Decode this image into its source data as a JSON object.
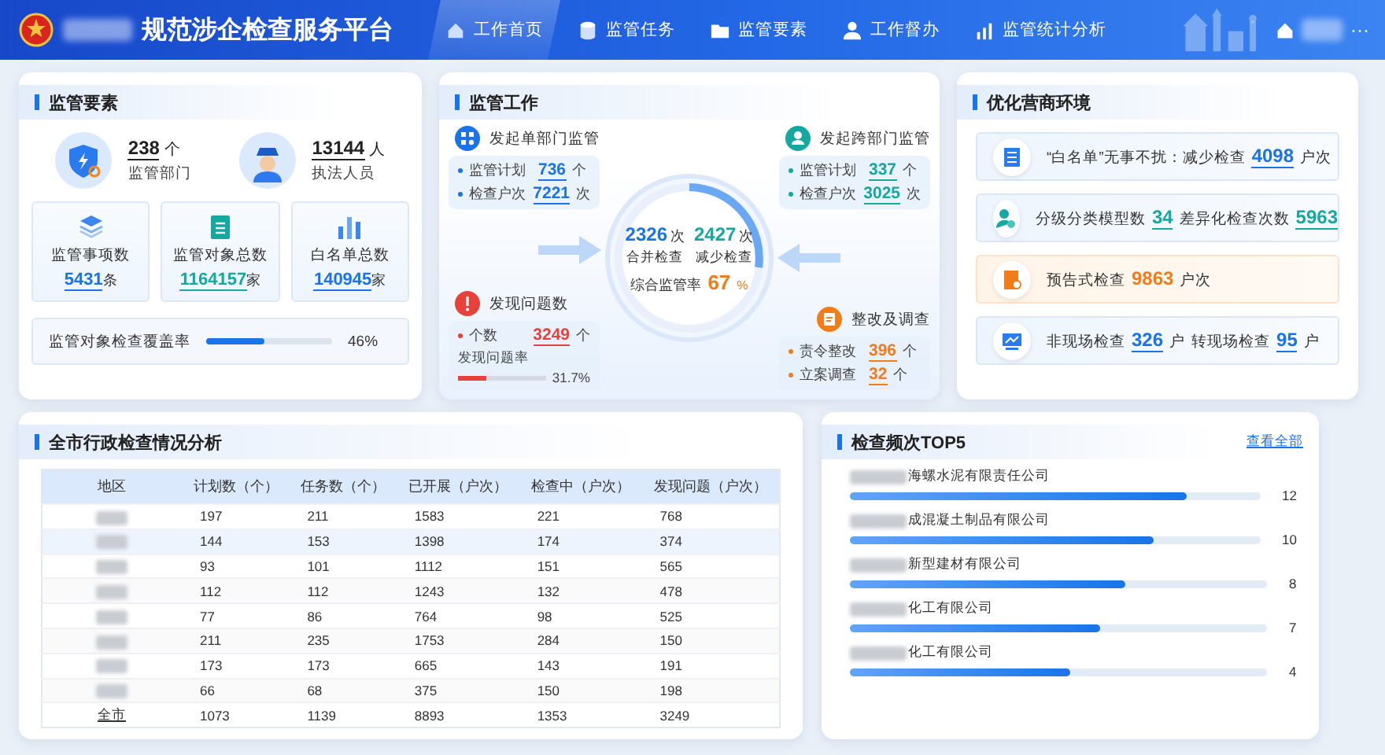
{
  "header": {
    "title": "规范涉企检查服务平台",
    "nav": [
      {
        "kind": "home",
        "label": "工作首页",
        "selected": true
      },
      {
        "kind": "database",
        "label": "监管任务",
        "selected": false
      },
      {
        "kind": "folder",
        "label": "监管要素",
        "selected": false
      },
      {
        "kind": "person",
        "label": "工作督办",
        "selected": false
      },
      {
        "kind": "chart",
        "label": "监管统计分析",
        "selected": false
      }
    ],
    "more": "···"
  },
  "elements": {
    "title": "监管要素",
    "stats": [
      {
        "kind": "shield",
        "value": "238",
        "unit": "个",
        "label": "监管部门"
      },
      {
        "kind": "officer",
        "value": "13144",
        "unit": "人",
        "label": "执法人员"
      }
    ],
    "tiles": [
      {
        "kind": "layers",
        "label": "监管事项数",
        "value": "5431",
        "unit": "条"
      },
      {
        "kind": "clipboard",
        "label": "监管对象总数",
        "value": "1164157",
        "unit": "家"
      },
      {
        "kind": "bars",
        "label": "白名单总数",
        "value": "140945",
        "unit": "家"
      }
    ],
    "coverage": {
      "label": "监管对象检查覆盖率",
      "level": 0.46,
      "reading": "46%"
    }
  },
  "work": {
    "title": "监管工作",
    "groups": [
      {
        "kind": "single",
        "title": "发起单部门监管",
        "rows": [
          {
            "label": "监管计划",
            "value": "736",
            "unit": "个"
          },
          {
            "label": "检查户次",
            "value": "7221",
            "unit": "次"
          }
        ]
      },
      {
        "kind": "cross",
        "title": "发起跨部门监管",
        "rows": [
          {
            "label": "监管计划",
            "value": "337",
            "unit": "个"
          },
          {
            "label": "检查户次",
            "value": "3025",
            "unit": "次"
          }
        ]
      },
      {
        "kind": "problem",
        "title": "发现问题数",
        "rows": [
          {
            "label": "个数",
            "value": "3249",
            "unit": "个"
          }
        ],
        "rate": {
          "label": "发现问题率",
          "level": 0.317,
          "reading": "31.7%"
        }
      },
      {
        "kind": "rectify",
        "title": "整改及调查",
        "rows": [
          {
            "label": "责令整改",
            "value": "396",
            "unit": "个"
          },
          {
            "label": "立案调查",
            "value": "32",
            "unit": "个"
          }
        ]
      }
    ],
    "center": {
      "stats": [
        {
          "kind": "blue",
          "value": "2326",
          "unit": "次",
          "label": "合并检查"
        },
        {
          "kind": "teal",
          "value": "2427",
          "unit": "次",
          "label": "减少检查"
        }
      ],
      "rate_label": "综合监管率",
      "rate_value": "67",
      "rate_unit": "%"
    }
  },
  "environment": {
    "title": "优化营商环境",
    "items": [
      {
        "kind": "whitelist",
        "parts": [
          {
            "kind": "text",
            "text": "“白名单”无事不扰：减少检查"
          },
          {
            "kind": "value",
            "text": "4098"
          },
          {
            "kind": "text",
            "text": "户次"
          }
        ]
      },
      {
        "kind": "grading",
        "parts": [
          {
            "kind": "text",
            "text": "分级分类模型数"
          },
          {
            "kind": "value",
            "text": "34"
          },
          {
            "kind": "text",
            "text": "差异化检查次数"
          },
          {
            "kind": "value",
            "text": "5963"
          }
        ]
      },
      {
        "kind": "warning",
        "parts": [
          {
            "kind": "text",
            "text": "预告式检查"
          },
          {
            "kind": "value",
            "text": "9863"
          },
          {
            "kind": "text",
            "text": "户次"
          }
        ]
      },
      {
        "kind": "remote",
        "parts": [
          {
            "kind": "text",
            "text": "非现场检查"
          },
          {
            "kind": "value",
            "text": "326"
          },
          {
            "kind": "text",
            "text": "户"
          },
          {
            "kind": "text",
            "text": "转现场检查"
          },
          {
            "kind": "value",
            "text": "95"
          },
          {
            "kind": "text",
            "text": "户"
          }
        ]
      }
    ]
  },
  "analysis": {
    "title": "全市行政检查情况分析",
    "table": {
      "columns": [
        "地区",
        "计划数（个）",
        "任务数（个）",
        "已开展（户次）",
        "检查中（户次）",
        "发现问题（户次）"
      ],
      "rows": [
        {
          "kind": "redacted",
          "selected": false,
          "cells": [
            "",
            "197",
            "211",
            "1583",
            "221",
            "768"
          ]
        },
        {
          "kind": "redacted",
          "selected": true,
          "cells": [
            "",
            "144",
            "153",
            "1398",
            "174",
            "374"
          ]
        },
        {
          "kind": "redacted",
          "selected": false,
          "cells": [
            "",
            "93",
            "101",
            "1112",
            "151",
            "565"
          ]
        },
        {
          "kind": "redacted",
          "selected": false,
          "cells": [
            "",
            "112",
            "112",
            "1243",
            "132",
            "478"
          ]
        },
        {
          "kind": "redacted",
          "selected": false,
          "cells": [
            "",
            "77",
            "86",
            "764",
            "98",
            "525"
          ]
        },
        {
          "kind": "redacted",
          "selected": false,
          "cells": [
            "",
            "211",
            "235",
            "1753",
            "284",
            "150"
          ]
        },
        {
          "kind": "redacted",
          "selected": false,
          "cells": [
            "",
            "173",
            "173",
            "665",
            "143",
            "191"
          ]
        },
        {
          "kind": "redacted",
          "selected": false,
          "cells": [
            "",
            "66",
            "68",
            "375",
            "150",
            "198"
          ]
        },
        {
          "kind": "total",
          "selected": false,
          "cells": [
            "全市",
            "1073",
            "1139",
            "8893",
            "1353",
            "3249"
          ]
        }
      ]
    }
  },
  "top5": {
    "title": "检查频次TOP5",
    "link": "查看全部",
    "items": [
      {
        "name": "海螺水泥有限责任公司",
        "count": "12",
        "level": 0.82
      },
      {
        "name": "成混凝土制品有限公司",
        "count": "10",
        "level": 0.74
      },
      {
        "name": "新型建材有限公司",
        "count": "8",
        "level": 0.66
      },
      {
        "name": "化工有限公司",
        "count": "7",
        "level": 0.6
      },
      {
        "name": "化工有限公司",
        "count": "4",
        "level": 0.53
      }
    ]
  }
}
